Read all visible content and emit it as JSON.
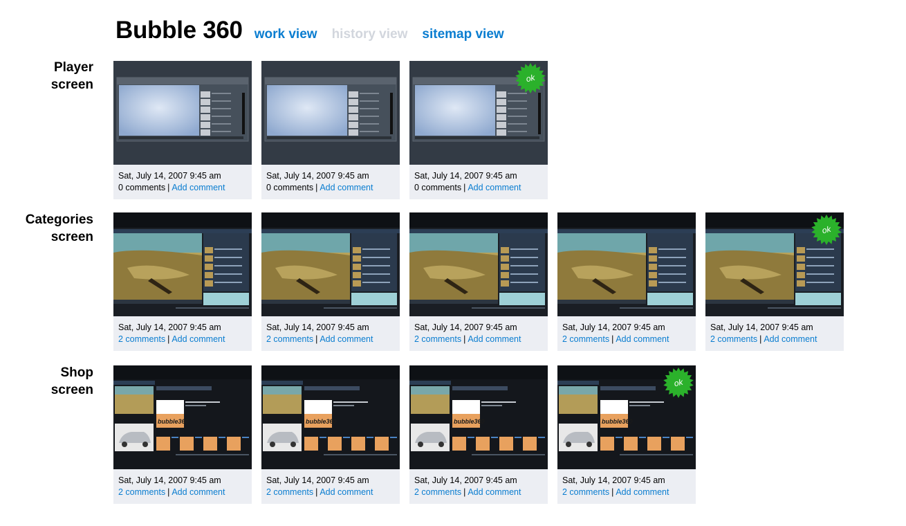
{
  "header": {
    "title": "Bubble 360",
    "nav": [
      {
        "label": "work view",
        "state": "active"
      },
      {
        "label": "history view",
        "state": "disabled"
      },
      {
        "label": "sitemap view",
        "state": "active"
      }
    ]
  },
  "rows": [
    {
      "label_line1": "Player",
      "label_line2": "screen",
      "screen_type": "player",
      "cards": [
        {
          "date": "Sat, July 14, 2007 9:45 am",
          "comments": "0 comments",
          "add": "Add comment",
          "ok": false
        },
        {
          "date": "Sat, July 14, 2007 9:45 am",
          "comments": "0 comments",
          "add": "Add comment",
          "ok": false
        },
        {
          "date": "Sat, July 14, 2007 9:45 am",
          "comments": "0 comments",
          "add": "Add comment",
          "ok": true
        }
      ]
    },
    {
      "label_line1": "Categories",
      "label_line2": "screen",
      "screen_type": "categories",
      "cards": [
        {
          "date": "Sat, July 14, 2007 9:45 am",
          "comments": "2 comments",
          "add": "Add comment",
          "ok": false
        },
        {
          "date": "Sat, July 14, 2007 9:45 am",
          "comments": "2 comments",
          "add": "Add comment",
          "ok": false
        },
        {
          "date": "Sat, July 14, 2007 9:45 am",
          "comments": "2 comments",
          "add": "Add comment",
          "ok": false
        },
        {
          "date": "Sat, July 14, 2007 9:45 am",
          "comments": "2 comments",
          "add": "Add comment",
          "ok": false
        },
        {
          "date": "Sat, July 14, 2007 9:45 am",
          "comments": "2 comments",
          "add": "Add comment",
          "ok": true
        }
      ]
    },
    {
      "label_line1": "Shop",
      "label_line2": "screen",
      "screen_type": "shop",
      "cards": [
        {
          "date": "Sat, July 14, 2007 9:45 am",
          "comments": "2 comments",
          "add": "Add comment",
          "ok": false
        },
        {
          "date": "Sat, July 14, 2007 9:45 am",
          "comments": "2 comments",
          "add": "Add comment",
          "ok": false
        },
        {
          "date": "Sat, July 14, 2007 9:45 am",
          "comments": "2 comments",
          "add": "Add comment",
          "ok": false
        },
        {
          "date": "Sat, July 14, 2007 9:45 am",
          "comments": "2 comments",
          "add": "Add comment",
          "ok": true
        }
      ]
    }
  ],
  "badge_text": "ok",
  "thumb_brand_text": "bubble360",
  "colors": {
    "link": "#0a7dd0",
    "disabled": "#d2d6dd",
    "caption_bg": "#eceef3",
    "badge": "#2bb12b",
    "thumb_bg": "#2c3540"
  }
}
